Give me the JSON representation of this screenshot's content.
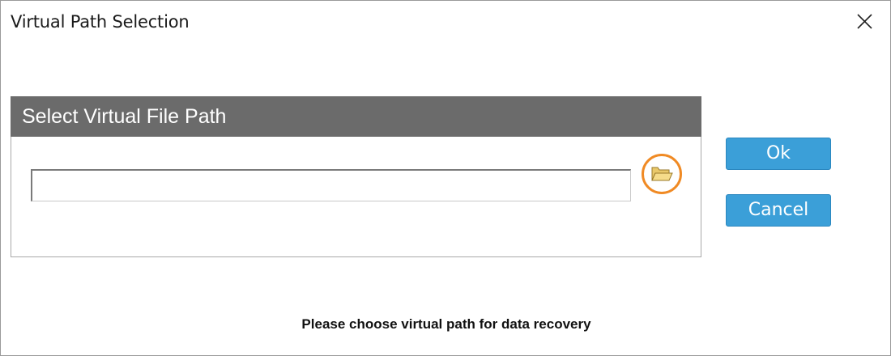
{
  "window": {
    "title": "Virtual Path Selection"
  },
  "group": {
    "header": "Select Virtual File Path"
  },
  "path_input": {
    "value": "",
    "placeholder": ""
  },
  "buttons": {
    "ok_label": "Ok",
    "cancel_label": "Cancel"
  },
  "hint": "Please choose virtual path for data recovery",
  "icons": {
    "close": "close-icon",
    "browse": "folder-open-icon"
  },
  "colors": {
    "header_bg": "#6b6b6b",
    "button_bg": "#3b9fd8",
    "browse_highlight": "#f08a24"
  }
}
